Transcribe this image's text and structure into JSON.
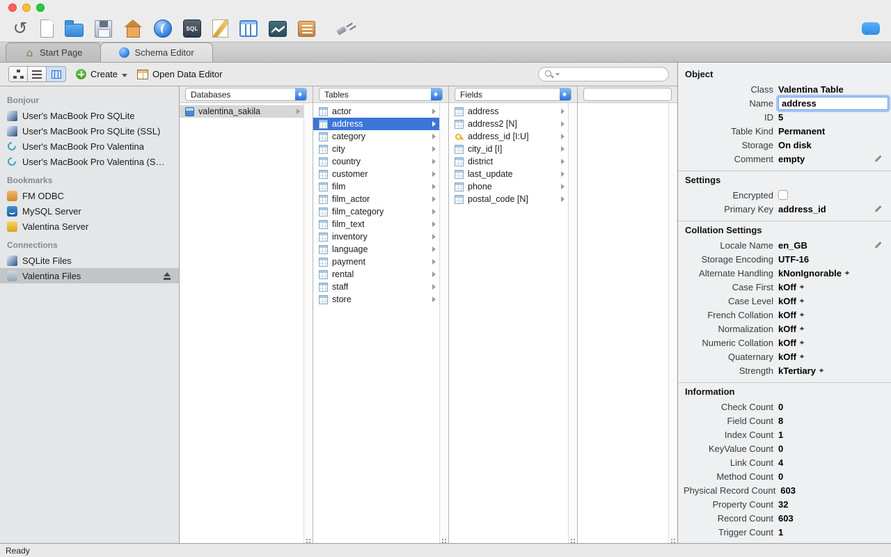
{
  "titlebar": {
    "buttons": [
      "close",
      "minimize",
      "zoom"
    ]
  },
  "toolbar": {
    "icons": [
      "undo-icon",
      "new-document-icon",
      "open-folder-icon",
      "save-icon",
      "start-page-icon",
      "valentina-home-icon",
      "sql-editor-icon",
      "diagram-icon",
      "schema-editor-icon",
      "server-admin-icon",
      "report-editor-icon",
      "connect-to-database-icon"
    ],
    "right_icons": [
      "feedback-icon"
    ]
  },
  "tabs": [
    {
      "label": "Start Page",
      "active": false
    },
    {
      "label": "Schema Editor",
      "active": true
    }
  ],
  "toolbar2": {
    "create_label": "Create",
    "open_data_editor_label": "Open Data Editor"
  },
  "search": {
    "placeholder": ""
  },
  "sidebar": {
    "sections": [
      {
        "title": "Bonjour",
        "items": [
          {
            "label": "User's MacBook Pro SQLite",
            "icon": "sqlite"
          },
          {
            "label": "User's MacBook Pro SQLite (SSL)",
            "icon": "sqlite"
          },
          {
            "label": "User's MacBook Pro Valentina",
            "icon": "valentina"
          },
          {
            "label": "User's MacBook Pro Valentina (S…",
            "icon": "valentina"
          }
        ]
      },
      {
        "title": "Bookmarks",
        "items": [
          {
            "label": "FM ODBC",
            "icon": "odbc"
          },
          {
            "label": "MySQL Server",
            "icon": "mysql"
          },
          {
            "label": "Valentina Server",
            "icon": "vserver"
          }
        ]
      },
      {
        "title": "Connections",
        "items": [
          {
            "label": "SQLite Files",
            "icon": "sqlite-files"
          },
          {
            "label": "Valentina Files",
            "icon": "vfiles",
            "selected": true,
            "eject": true
          }
        ]
      }
    ]
  },
  "browser": {
    "columns": [
      {
        "header": "Databases",
        "items": [
          {
            "label": "valentina_sakila",
            "icon": "database",
            "arrow": true,
            "selected": "gray"
          }
        ]
      },
      {
        "header": "Tables",
        "items": [
          {
            "label": "actor",
            "icon": "table",
            "arrow": true
          },
          {
            "label": "address",
            "icon": "table",
            "arrow": true,
            "selected": "blue"
          },
          {
            "label": "category",
            "icon": "table",
            "arrow": true
          },
          {
            "label": "city",
            "icon": "table",
            "arrow": true
          },
          {
            "label": "country",
            "icon": "table",
            "arrow": true
          },
          {
            "label": "customer",
            "icon": "table",
            "arrow": true
          },
          {
            "label": "film",
            "icon": "table",
            "arrow": true
          },
          {
            "label": "film_actor",
            "icon": "table",
            "arrow": true
          },
          {
            "label": "film_category",
            "icon": "table",
            "arrow": true
          },
          {
            "label": "film_text",
            "icon": "table",
            "arrow": true
          },
          {
            "label": "inventory",
            "icon": "table",
            "arrow": true
          },
          {
            "label": "language",
            "icon": "table",
            "arrow": true
          },
          {
            "label": "payment",
            "icon": "table",
            "arrow": true
          },
          {
            "label": "rental",
            "icon": "table",
            "arrow": true
          },
          {
            "label": "staff",
            "icon": "table",
            "arrow": true
          },
          {
            "label": "store",
            "icon": "table",
            "arrow": true
          }
        ]
      },
      {
        "header": "Fields",
        "items": [
          {
            "label": "address",
            "icon": "field",
            "arrow": true
          },
          {
            "label": "address2 [N]",
            "icon": "field",
            "arrow": true
          },
          {
            "label": "address_id [I:U]",
            "icon": "key",
            "arrow": true
          },
          {
            "label": "city_id [I]",
            "icon": "field",
            "arrow": true
          },
          {
            "label": "district",
            "icon": "field",
            "arrow": true
          },
          {
            "label": "last_update",
            "icon": "field",
            "arrow": true
          },
          {
            "label": "phone",
            "icon": "field",
            "arrow": true
          },
          {
            "label": "postal_code [N]",
            "icon": "field",
            "arrow": true
          }
        ]
      },
      {
        "header": "",
        "items": []
      }
    ]
  },
  "inspector": {
    "sections": [
      {
        "title": "Object",
        "rows": [
          {
            "label": "Class",
            "value": "Valentina Table"
          },
          {
            "label": "Name",
            "value": "address",
            "type": "input"
          },
          {
            "label": "ID",
            "value": "5"
          },
          {
            "label": "Table Kind",
            "value": "Permanent"
          },
          {
            "label": "Storage",
            "value": "On disk"
          },
          {
            "label": "Comment",
            "value": "empty",
            "edit": true
          }
        ]
      },
      {
        "title": "Settings",
        "rows": [
          {
            "label": "Encrypted",
            "type": "checkbox",
            "checked": false
          },
          {
            "label": "Primary Key",
            "value": "address_id",
            "edit": true
          }
        ]
      },
      {
        "title": "Collation Settings",
        "rows": [
          {
            "label": "Locale Name",
            "value": "en_GB",
            "edit": true
          },
          {
            "label": "Storage Encoding",
            "value": "UTF-16"
          },
          {
            "label": "Alternate Handling",
            "value": "kNonIgnorable",
            "type": "dropdown"
          },
          {
            "label": "Case First",
            "value": "kOff",
            "type": "dropdown"
          },
          {
            "label": "Case Level",
            "value": "kOff",
            "type": "dropdown"
          },
          {
            "label": "French Collation",
            "value": "kOff",
            "type": "dropdown"
          },
          {
            "label": "Normalization",
            "value": "kOff",
            "type": "dropdown"
          },
          {
            "label": "Numeric Collation",
            "value": "kOff",
            "type": "dropdown"
          },
          {
            "label": "Quaternary",
            "value": "kOff",
            "type": "dropdown"
          },
          {
            "label": "Strength",
            "value": "kTertiary",
            "type": "dropdown"
          }
        ]
      },
      {
        "title": "Information",
        "rows": [
          {
            "label": "Check Count",
            "value": "0"
          },
          {
            "label": "Field Count",
            "value": "8"
          },
          {
            "label": "Index Count",
            "value": "1"
          },
          {
            "label": "KeyValue Count",
            "value": "0"
          },
          {
            "label": "Link Count",
            "value": "4"
          },
          {
            "label": "Method Count",
            "value": "0"
          },
          {
            "label": "Physical Record Count",
            "value": "603"
          },
          {
            "label": "Property Count",
            "value": "32"
          },
          {
            "label": "Record Count",
            "value": "603"
          },
          {
            "label": "Trigger Count",
            "value": "1"
          }
        ]
      }
    ]
  },
  "statusbar": {
    "text": "Ready"
  }
}
